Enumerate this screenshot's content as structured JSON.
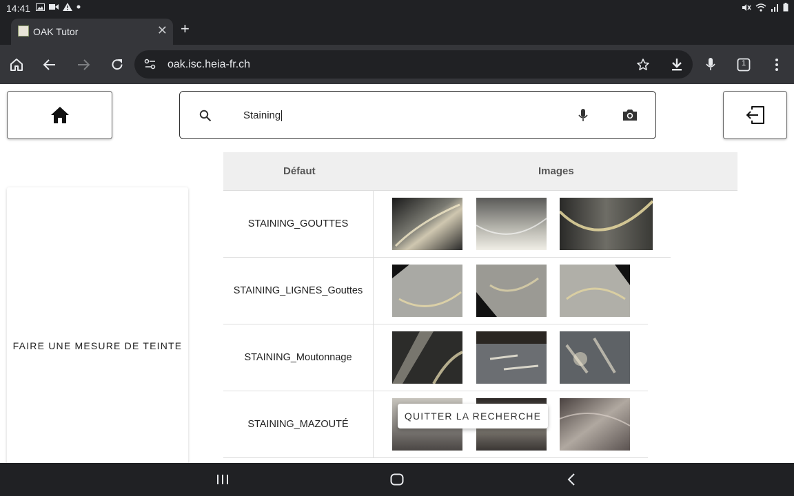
{
  "status_bar": {
    "time": "14:41"
  },
  "browser": {
    "tab_title": "OAK Tutor",
    "url": "oak.isc.heia-fr.ch",
    "tab_count": "1"
  },
  "search": {
    "value": "Staining"
  },
  "side_action": {
    "label": "FAIRE UNE MESURE DE TEINTE"
  },
  "table": {
    "headers": {
      "defect": "Défaut",
      "images": "Images"
    },
    "rows": [
      {
        "name": "STAINING_GOUTTES",
        "image_count": 3
      },
      {
        "name": "STAINING_LIGNES_Gouttes",
        "image_count": 3
      },
      {
        "name": "STAINING_Moutonnage",
        "image_count": 3
      },
      {
        "name": "STAINING_MAZOUTÉ",
        "image_count": 3
      }
    ]
  },
  "snackbar": {
    "label": "QUITTER LA RECHERCHE"
  },
  "colors": {
    "browser_dark": "#202124",
    "toolbar": "#35363a",
    "header_bg": "#efefef"
  }
}
